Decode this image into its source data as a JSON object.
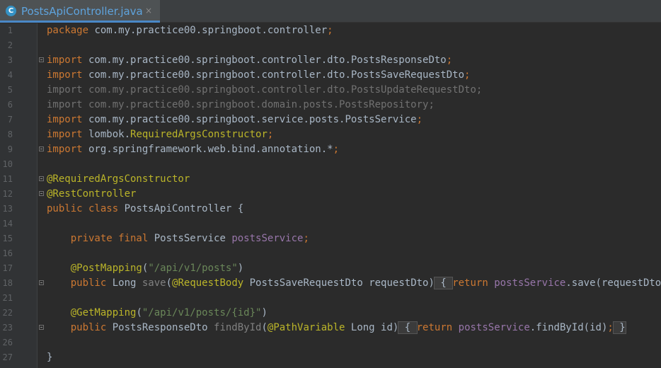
{
  "tab": {
    "icon_letter": "C",
    "title": "PostsApiController.java",
    "close": "×"
  },
  "lines": [
    {
      "num": "1",
      "fold": false,
      "tokens": [
        [
          "k",
          "package"
        ],
        [
          "p",
          " com.my.practice00.springboot.controller"
        ],
        [
          "k",
          ";"
        ]
      ]
    },
    {
      "num": "2",
      "fold": false,
      "tokens": []
    },
    {
      "num": "3",
      "fold": true,
      "tokens": [
        [
          "k",
          "import"
        ],
        [
          "p",
          " com.my.practice00.springboot.controller.dto.PostsResponseDto"
        ],
        [
          "k",
          ";"
        ]
      ]
    },
    {
      "num": "4",
      "fold": false,
      "tokens": [
        [
          "k",
          "import"
        ],
        [
          "p",
          " com.my.practice00.springboot.controller.dto.PostsSaveRequestDto"
        ],
        [
          "k",
          ";"
        ]
      ]
    },
    {
      "num": "5",
      "fold": false,
      "tokens": [
        [
          "g",
          "import com.my.practice00.springboot.controller.dto.PostsUpdateRequestDto;"
        ]
      ]
    },
    {
      "num": "6",
      "fold": false,
      "tokens": [
        [
          "g",
          "import com.my.practice00.springboot.domain.posts.PostsRepository;"
        ]
      ]
    },
    {
      "num": "7",
      "fold": false,
      "tokens": [
        [
          "k",
          "import"
        ],
        [
          "p",
          " com.my.practice00.springboot.service.posts.PostsService"
        ],
        [
          "k",
          ";"
        ]
      ]
    },
    {
      "num": "8",
      "fold": false,
      "tokens": [
        [
          "k",
          "import"
        ],
        [
          "p",
          " lombok."
        ],
        [
          "a",
          "RequiredArgsConstructor"
        ],
        [
          "k",
          ";"
        ]
      ]
    },
    {
      "num": "9",
      "fold": true,
      "tokens": [
        [
          "k",
          "import"
        ],
        [
          "p",
          " org.springframework.web.bind.annotation.*"
        ],
        [
          "k",
          ";"
        ]
      ]
    },
    {
      "num": "10",
      "fold": false,
      "tokens": []
    },
    {
      "num": "11",
      "fold": true,
      "tokens": [
        [
          "a",
          "@RequiredArgsConstructor"
        ]
      ]
    },
    {
      "num": "12",
      "fold": true,
      "tokens": [
        [
          "a",
          "@RestController"
        ]
      ]
    },
    {
      "num": "13",
      "fold": false,
      "tokens": [
        [
          "k",
          "public class"
        ],
        [
          "p",
          " PostsApiController {"
        ]
      ]
    },
    {
      "num": "14",
      "fold": false,
      "tokens": []
    },
    {
      "num": "15",
      "fold": false,
      "tokens": [
        [
          "p",
          "    "
        ],
        [
          "k",
          "private final"
        ],
        [
          "p",
          " PostsService "
        ],
        [
          "f",
          "postsService"
        ],
        [
          "k",
          ";"
        ]
      ]
    },
    {
      "num": "16",
      "fold": false,
      "tokens": []
    },
    {
      "num": "17",
      "fold": false,
      "tokens": [
        [
          "p",
          "    "
        ],
        [
          "a",
          "@PostMapping"
        ],
        [
          "p",
          "("
        ],
        [
          "s",
          "\"/api/v1/posts\""
        ],
        [
          "p",
          ")"
        ]
      ]
    },
    {
      "num": "18",
      "fold": true,
      "tokens": [
        [
          "p",
          "    "
        ],
        [
          "k",
          "public"
        ],
        [
          "p",
          " Long "
        ],
        [
          "i",
          "save"
        ],
        [
          "p",
          "("
        ],
        [
          "a",
          "@RequestBody"
        ],
        [
          "p",
          " PostsSaveRequestDto requestDto)"
        ],
        [
          "b",
          " { "
        ],
        [
          "k",
          "return"
        ],
        [
          "p",
          " "
        ],
        [
          "f",
          "postsService"
        ],
        [
          "p",
          ".save(requestDto)"
        ],
        [
          "k",
          ";"
        ],
        [
          "b",
          " }"
        ]
      ]
    },
    {
      "num": "21",
      "fold": false,
      "tokens": []
    },
    {
      "num": "22",
      "fold": false,
      "tokens": [
        [
          "p",
          "    "
        ],
        [
          "a",
          "@GetMapping"
        ],
        [
          "p",
          "("
        ],
        [
          "s",
          "\"/api/v1/posts/{id}\""
        ],
        [
          "p",
          ")"
        ]
      ]
    },
    {
      "num": "23",
      "fold": true,
      "tokens": [
        [
          "p",
          "    "
        ],
        [
          "k",
          "public"
        ],
        [
          "p",
          " PostsResponseDto "
        ],
        [
          "i",
          "findById"
        ],
        [
          "p",
          "("
        ],
        [
          "a",
          "@PathVariable"
        ],
        [
          "p",
          " Long id)"
        ],
        [
          "b",
          " { "
        ],
        [
          "k",
          "return"
        ],
        [
          "p",
          " "
        ],
        [
          "f",
          "postsService"
        ],
        [
          "p",
          ".findById(id)"
        ],
        [
          "k",
          ";"
        ],
        [
          "b",
          " }"
        ]
      ]
    },
    {
      "num": "26",
      "fold": false,
      "tokens": []
    },
    {
      "num": "27",
      "fold": false,
      "tokens": [
        [
          "p",
          "}"
        ]
      ]
    }
  ]
}
